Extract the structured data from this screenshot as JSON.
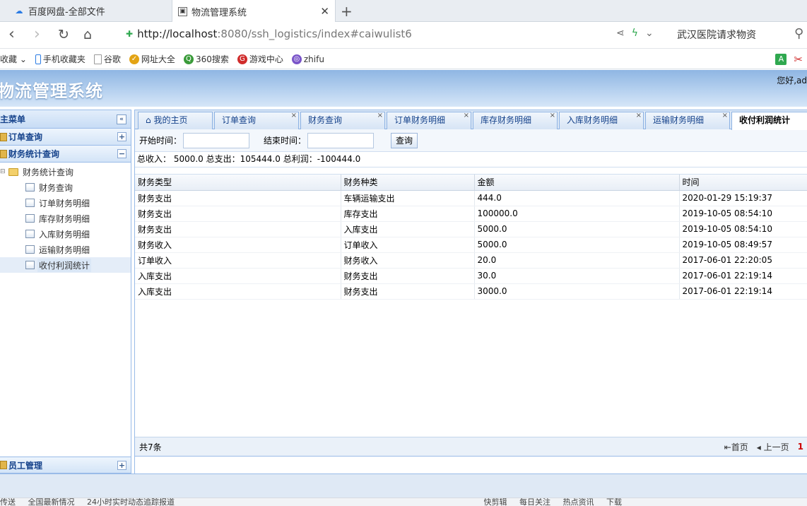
{
  "browser": {
    "tabs": [
      {
        "title": "百度网盘-全部文件"
      },
      {
        "title": "物流管理系统"
      }
    ],
    "url_host": "http://localhost",
    "url_path": ":8080/ssh_logistics/index#caiwulist6",
    "search_text": "武汉医院请求物资",
    "bookmarks": [
      "收藏",
      "手机收藏夹",
      "谷歌",
      "网址大全",
      "360搜索",
      "游戏中心",
      "zhifu"
    ]
  },
  "app": {
    "title": "物流管理系统",
    "welcome": "您好,ad"
  },
  "sidebar": {
    "header": "主菜单",
    "sections": [
      {
        "label": "订单查询"
      },
      {
        "label": "财务统计查询"
      }
    ],
    "tree_parent": "财务统计查询",
    "tree_items": [
      "财务查询",
      "订单财务明细",
      "库存财务明细",
      "入库财务明细",
      "运输财务明细",
      "收付利润统计"
    ],
    "bottom_section": "员工管理"
  },
  "tabs": [
    "我的主页",
    "订单查询",
    "财务查询",
    "订单财务明细",
    "库存财务明细",
    "入库财务明细",
    "运输财务明细",
    "收付利润统计"
  ],
  "search": {
    "start_label": "开始时间：",
    "end_label": "结束时间：",
    "query_button": "查询"
  },
  "summary": "总收入： 5000.0 总支出：105444.0 总利润：-100444.0",
  "grid": {
    "columns": [
      "财务类型",
      "财务种类",
      "金额",
      "时间"
    ],
    "rows": [
      [
        "财务支出",
        "车辆运输支出",
        "444.0",
        "2020-01-29 15:19:37"
      ],
      [
        "财务支出",
        "库存支出",
        "100000.0",
        "2019-10-05 08:54:10"
      ],
      [
        "财务支出",
        "入库支出",
        "5000.0",
        "2019-10-05 08:54:10"
      ],
      [
        "财务收入",
        "订单收入",
        "5000.0",
        "2019-10-05 08:49:57"
      ],
      [
        "订单收入",
        "财务收入",
        "20.0",
        "2017-06-01 22:20:05"
      ],
      [
        "入库支出",
        "财务支出",
        "30.0",
        "2017-06-01 22:19:14"
      ],
      [
        "入库支出",
        "财务支出",
        "3000.0",
        "2017-06-01 22:19:14"
      ]
    ]
  },
  "pager": {
    "total": "共7条",
    "first": "首页",
    "prev": "上一页",
    "page": "1"
  },
  "statusbar": [
    "传送",
    "全国最新情况",
    "24小时实时动态追踪报道",
    "快剪辑",
    "每日关注",
    "热点资讯",
    "下载"
  ]
}
